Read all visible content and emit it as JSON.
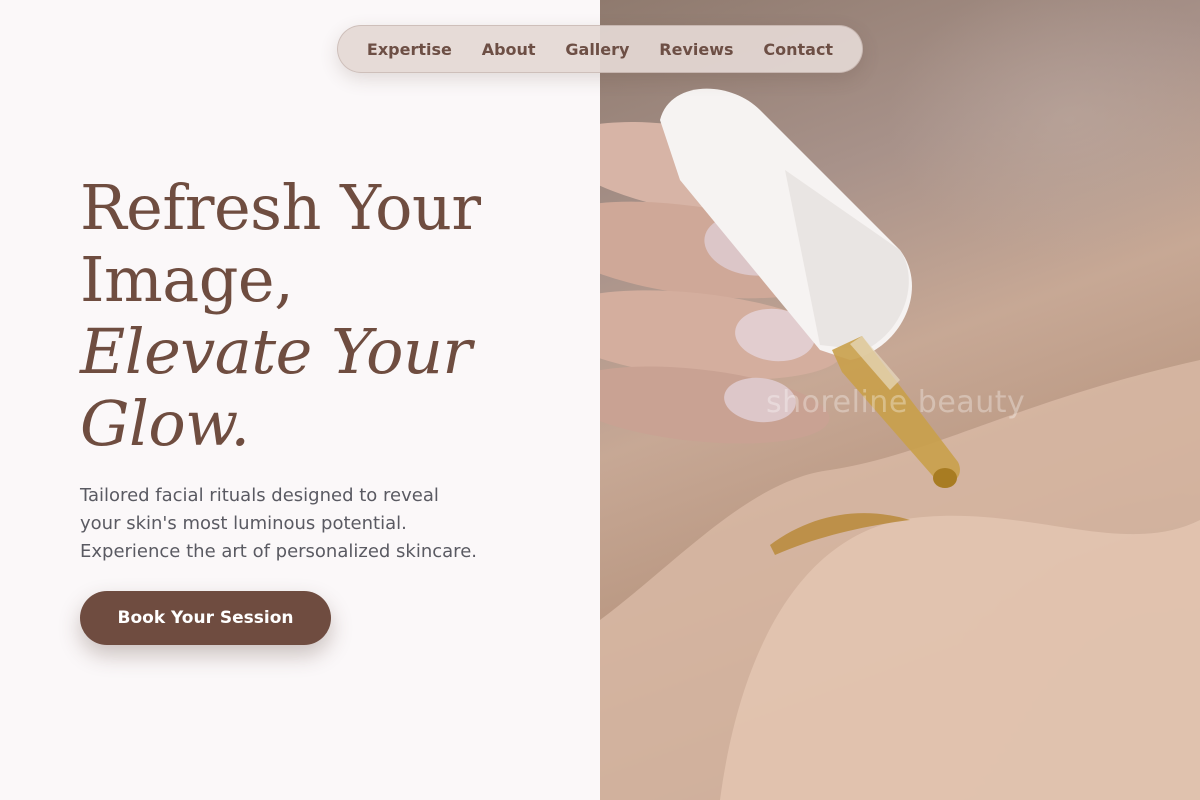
{
  "nav": {
    "items": [
      "Expertise",
      "About",
      "Gallery",
      "Reviews",
      "Contact"
    ]
  },
  "hero": {
    "headline_lines": [
      "Refresh Your",
      "Image,"
    ],
    "headline_italic_lines": [
      "Elevate Your",
      "Glow."
    ],
    "subtitle_lines": [
      "Tailored facial rituals designed to reveal",
      "your skin's most luminous potential.",
      "Experience the art of personalized skincare."
    ],
    "cta_label": "Book Your Session"
  },
  "photo": {
    "watermark": "shoreline beauty"
  },
  "colors": {
    "brand_brown": "#6f4c40",
    "nav_text": "#6d4f45",
    "body_text": "#5a5a62",
    "page_bg": "#fbf8f9"
  },
  "icons": [
    "dropper-photo"
  ]
}
